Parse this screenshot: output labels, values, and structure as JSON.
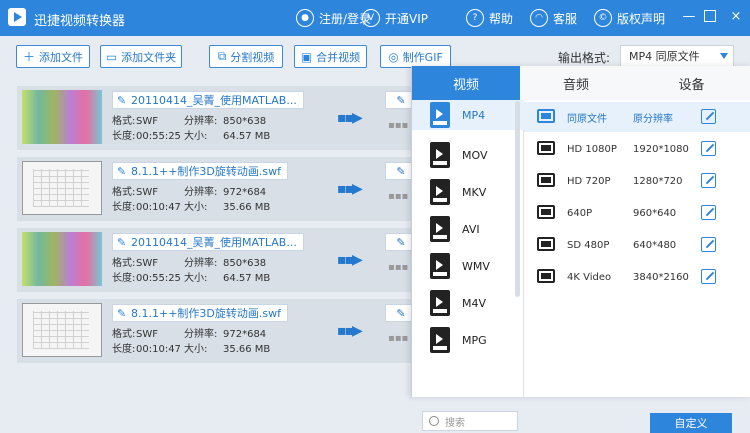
{
  "app": {
    "title": "迅捷视频转换器"
  },
  "titlebar": {
    "items": [
      {
        "label": "注册/登录",
        "icon": "user-icon"
      },
      {
        "label": "开通VIP",
        "icon": "vip-icon"
      },
      {
        "label": "帮助",
        "icon": "help-icon"
      },
      {
        "label": "客服",
        "icon": "headset-icon"
      },
      {
        "label": "版权声明",
        "icon": "copyright-icon"
      }
    ],
    "window_controls": [
      "minimize",
      "maximize",
      "close"
    ]
  },
  "toolbar": {
    "buttons": [
      "添加文件",
      "添加文件夹",
      "分割视频",
      "合并视频",
      "制作GIF"
    ],
    "output_format_label": "输出格式:",
    "output_format_value": "MP4 同原文件"
  },
  "files": [
    {
      "name": "20110414_吴菁_使用MATLAB...",
      "format": "SWF",
      "resolution": "850*638",
      "duration": "00:55:25",
      "size": "64.57 MB"
    },
    {
      "name": "8.1.1++制作3D旋转动画.swf",
      "format": "SWF",
      "resolution": "972*684",
      "duration": "00:10:47",
      "size": "35.66 MB"
    },
    {
      "name": "20110414_吴菁_使用MATLAB...",
      "format": "SWF",
      "resolution": "850*638",
      "duration": "00:55:25",
      "size": "64.57 MB"
    },
    {
      "name": "8.1.1++制作3D旋转动画.swf",
      "format": "SWF",
      "resolution": "972*684",
      "duration": "00:10:47",
      "size": "35.66 MB"
    }
  ],
  "meta_labels": {
    "format": "格式:",
    "duration": "长度:",
    "resolution": "分辨率:",
    "size": "大小:"
  },
  "format_panel": {
    "tabs": [
      "视频",
      "音频",
      "设备"
    ],
    "formats": [
      {
        "name": "MP4",
        "selected": true
      },
      {
        "name": "MOV"
      },
      {
        "name": "MKV"
      },
      {
        "name": "AVI"
      },
      {
        "name": "WMV"
      },
      {
        "name": "M4V"
      },
      {
        "name": "MPG"
      }
    ],
    "presets": [
      {
        "name": "同原文件",
        "resolution": "原分辨率",
        "selected": true
      },
      {
        "name": "HD 1080P",
        "resolution": "1920*1080"
      },
      {
        "name": "HD 720P",
        "resolution": "1280*720"
      },
      {
        "name": "640P",
        "resolution": "960*640"
      },
      {
        "name": "SD 480P",
        "resolution": "640*480"
      },
      {
        "name": "4K Video",
        "resolution": "3840*2160"
      }
    ],
    "search_placeholder": "搜索",
    "custom_button": "自定义"
  }
}
